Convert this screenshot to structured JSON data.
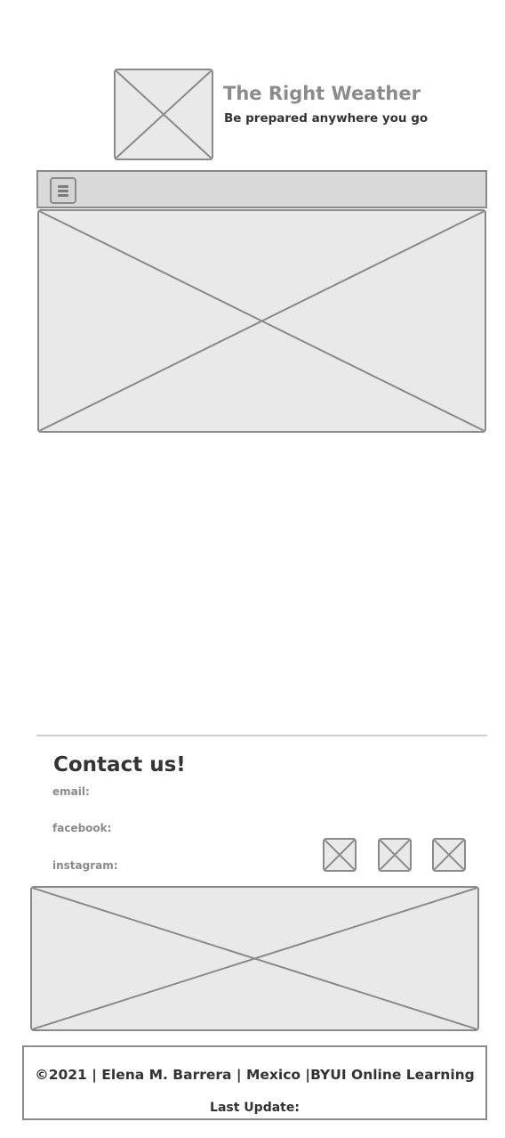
{
  "header": {
    "title": "The Right Weather",
    "tagline": "Be prepared anywhere you go",
    "logo_icon": "image-placeholder-icon"
  },
  "nav": {
    "menu_icon": "hamburger-menu-icon"
  },
  "hero": {
    "image_icon": "image-placeholder-icon"
  },
  "contact": {
    "heading": "Contact us!",
    "email_label": "email:",
    "facebook_label": "facebook:",
    "instagram_label": "instagram:",
    "social_icons": [
      "image-placeholder-icon",
      "image-placeholder-icon",
      "image-placeholder-icon"
    ]
  },
  "footer": {
    "copyright": "©2021 | Elena M. Barrera | Mexico |BYUI Online Learning",
    "last_update": "Last Update:"
  },
  "colors": {
    "placeholder_fill": "#e9e9e9",
    "placeholder_stroke": "#8a8a8a",
    "navbar_fill": "#d9d9d9",
    "title_text": "#8c8c8c",
    "body_text": "#333333"
  }
}
